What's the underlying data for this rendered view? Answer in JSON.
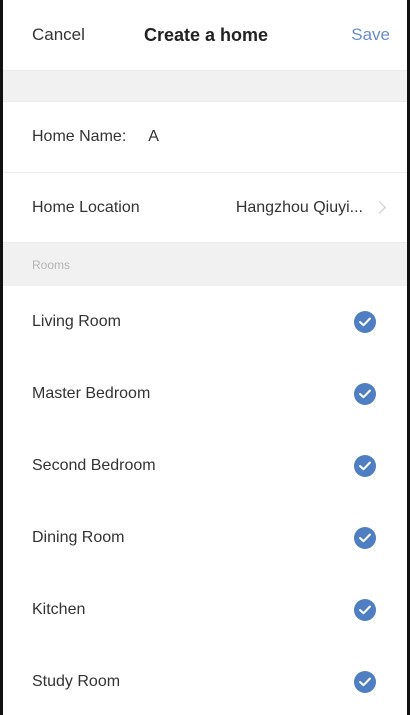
{
  "header": {
    "cancel_label": "Cancel",
    "title": "Create a home",
    "save_label": "Save"
  },
  "form": {
    "name_label": "Home Name",
    "name_value": "A",
    "location_label": "Home Location",
    "location_value": "Hangzhou Qiuyi..."
  },
  "rooms": {
    "section_label": "Rooms",
    "items": [
      {
        "label": "Living Room",
        "checked": true
      },
      {
        "label": "Master Bedroom",
        "checked": true
      },
      {
        "label": "Second Bedroom",
        "checked": true
      },
      {
        "label": "Dining Room",
        "checked": true
      },
      {
        "label": "Kitchen",
        "checked": true
      },
      {
        "label": "Study Room",
        "checked": true
      }
    ]
  },
  "colors": {
    "accent": "#4f7ec2",
    "save_link": "#6a8cc8",
    "section_bg": "#f1f1f1"
  },
  "icons": {
    "check": "check-circle-icon",
    "chevron": "chevron-right-icon"
  }
}
